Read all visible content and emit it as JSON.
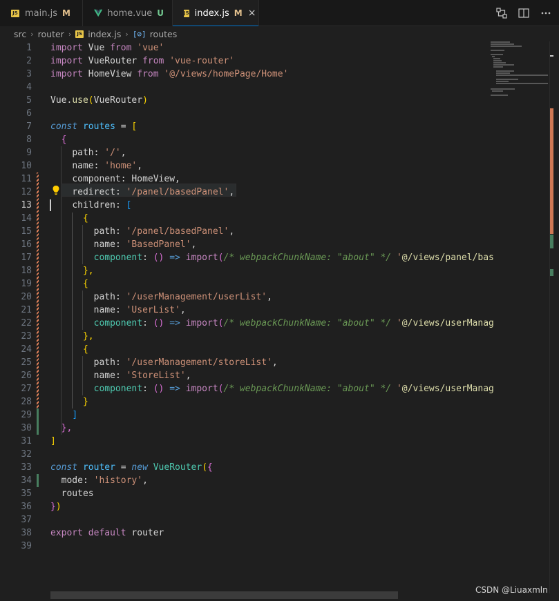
{
  "tabs": [
    {
      "name": "main.js",
      "status": "M"
    },
    {
      "name": "home.vue",
      "status": "U"
    },
    {
      "name": "index.js",
      "status": "M",
      "close": "×"
    }
  ],
  "breadcrumb": {
    "parts": [
      "src",
      "router",
      "index.js",
      "routes"
    ]
  },
  "code": {
    "l1": [
      "import",
      " Vue ",
      "from",
      " 'vue'"
    ],
    "l2": [
      "import",
      " VueRouter ",
      "from",
      " 'vue-router'"
    ],
    "l3": [
      "import",
      " HomeView ",
      "from",
      " '@/views/homePage/Home'"
    ],
    "l5a": "Vue",
    "l5b": ".",
    "l5c": "use",
    "l5d": "(",
    "l5e": "VueRouter",
    "l5f": ")",
    "l7a": "const",
    "l7b": " routes",
    "l7c": " = ",
    "l7d": "[",
    "l8": "{",
    "l9a": "path",
    "l9b": ": ",
    "l9c": "'/'",
    "l9d": ",",
    "l10a": "name",
    "l10b": ": ",
    "l10c": "'home'",
    "l10d": ",",
    "l11a": "component",
    "l11b": ": ",
    "l11c": "HomeView",
    "l11d": ",",
    "l12a": "redirect",
    "l12b": ": ",
    "l12c": "'/panel/basedPanel'",
    "l12d": ",",
    "l13a": "children",
    "l13b": ": ",
    "l13c": "[",
    "l14": "{",
    "l15a": "path",
    "l15b": ": ",
    "l15c": "'/panel/basedPanel'",
    "l15d": ",",
    "l16a": "name",
    "l16b": ": ",
    "l16c": "'BasedPanel'",
    "l16d": ",",
    "l17a": "component",
    "l17b": ": ",
    "l17c": "()",
    "l17d": " => ",
    "l17e": "import",
    "l17f": "(",
    "l17g": "/* webpackChunkName: \"about\" */",
    "l17h": " '",
    "l17i": "@/views/panel/bas",
    "l18": "},",
    "l19": "{",
    "l20a": "path",
    "l20b": ": ",
    "l20c": "'/userManagement/userList'",
    "l20d": ",",
    "l21a": "name",
    "l21b": ": ",
    "l21c": "'UserList'",
    "l21d": ",",
    "l22a": "component",
    "l22b": ": ",
    "l22c": "()",
    "l22d": " => ",
    "l22e": "import",
    "l22f": "(",
    "l22g": "/* webpackChunkName: \"about\" */",
    "l22h": " '",
    "l22i": "@/views/userManag",
    "l23": "},",
    "l24": "{",
    "l25a": "path",
    "l25b": ": ",
    "l25c": "'/userManagement/storeList'",
    "l25d": ",",
    "l26a": "name",
    "l26b": ": ",
    "l26c": "'StoreList'",
    "l26d": ",",
    "l27a": "component",
    "l27b": ": ",
    "l27c": "()",
    "l27d": " => ",
    "l27e": "import",
    "l27f": "(",
    "l27g": "/* webpackChunkName: \"about\" */",
    "l27h": " '",
    "l27i": "@/views/userManag",
    "l28": "}",
    "l29": "]",
    "l30": "},",
    "l31": "]",
    "l33a": "const",
    "l33b": " router",
    "l33c": " = ",
    "l33d": "new",
    "l33e": " VueRouter",
    "l33f": "(",
    "l33g": "{",
    "l34a": "mode",
    "l34b": ": ",
    "l34c": "'history'",
    "l34d": ",",
    "l35": "routes",
    "l36a": "}",
    "l36b": ")",
    "l38a": "export",
    "l38b": " default",
    "l38c": " router"
  },
  "line_numbers": [
    "1",
    "2",
    "3",
    "4",
    "5",
    "6",
    "7",
    "8",
    "9",
    "10",
    "11",
    "12",
    "13",
    "14",
    "15",
    "16",
    "17",
    "18",
    "19",
    "20",
    "21",
    "22",
    "23",
    "24",
    "25",
    "26",
    "27",
    "28",
    "29",
    "30",
    "31",
    "32",
    "33",
    "34",
    "35",
    "36",
    "37",
    "38",
    "39"
  ],
  "watermark": "CSDN @Liuaxmln",
  "colors": {
    "accent": "#0078d4",
    "modified": "#e2c08d",
    "untracked": "#73c991"
  }
}
